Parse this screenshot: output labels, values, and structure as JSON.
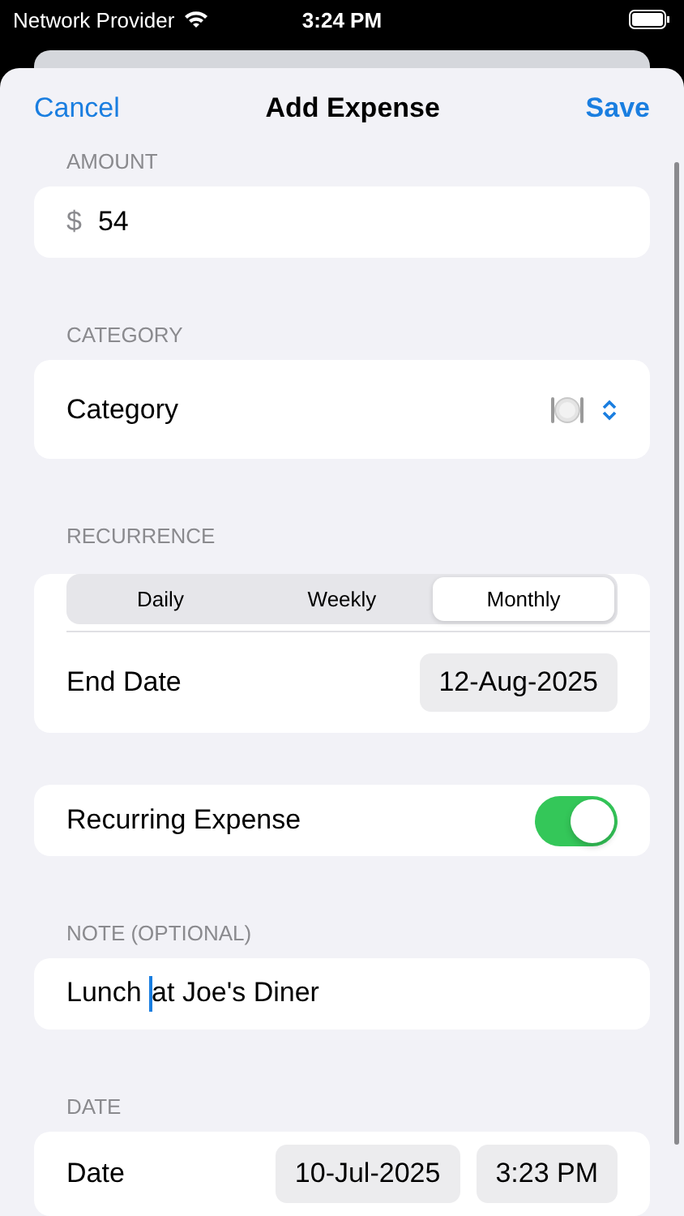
{
  "status_bar": {
    "carrier": "Network Provider",
    "time": "3:24 PM"
  },
  "nav": {
    "cancel": "Cancel",
    "title": "Add Expense",
    "save": "Save"
  },
  "amount": {
    "header": "AMOUNT",
    "currency": "$",
    "value": "54"
  },
  "category": {
    "header": "CATEGORY",
    "label": "Category"
  },
  "recurrence": {
    "header": "RECURRENCE",
    "segments": [
      {
        "label": "Daily",
        "selected": false
      },
      {
        "label": "Weekly",
        "selected": false
      },
      {
        "label": "Monthly",
        "selected": true
      }
    ],
    "end_date": {
      "label": "End Date",
      "value": "12-Aug-2025"
    }
  },
  "recurring": {
    "label": "Recurring Expense",
    "on": true
  },
  "note": {
    "header": "NOTE (OPTIONAL)",
    "value": "Lunch at Joe's Diner"
  },
  "date": {
    "header": "DATE",
    "label": "Date",
    "date": "10-Jul-2025",
    "time": "3:23 PM"
  }
}
